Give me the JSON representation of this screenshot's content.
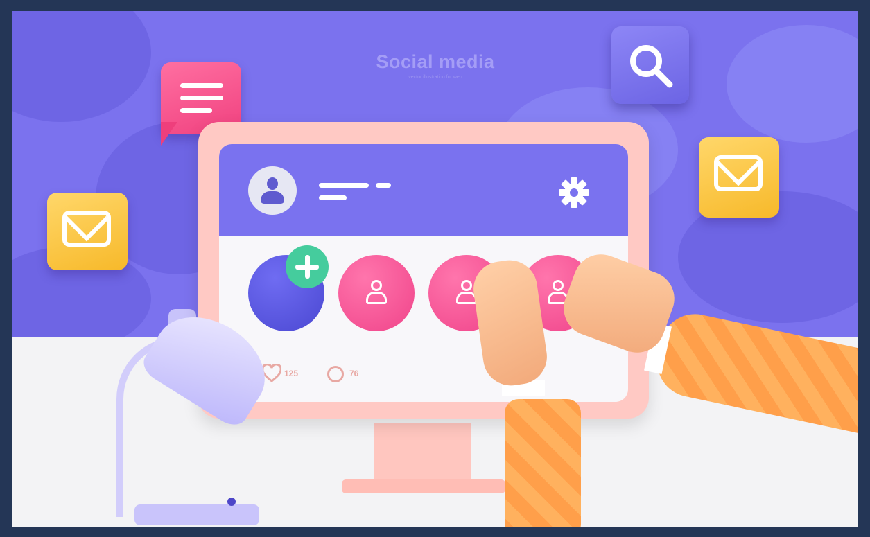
{
  "header": {
    "title": "Social media",
    "subtitle": "vector illustration for web"
  },
  "profile": {
    "avatar_icon": "user-avatar-icon",
    "settings_icon": "gear-icon"
  },
  "stats": {
    "likes": "125",
    "comments": "76",
    "likes_icon": "heart-icon",
    "comments_icon": "comment-icon"
  },
  "floating_icons": [
    "chat-icon",
    "search-icon",
    "mail-icon",
    "mail-icon"
  ],
  "friends": {
    "add_icon": "plus-icon",
    "count": 3,
    "friend_icon": "user-icon"
  },
  "colors": {
    "background_purple": "#7b72ee",
    "frame_navy": "#243656",
    "monitor_pink": "#ffc9c4",
    "accent_pink": "#f0448a",
    "accent_blue": "#4b48d2",
    "accent_green": "#45cc9d",
    "accent_yellow": "#f7b92a"
  }
}
